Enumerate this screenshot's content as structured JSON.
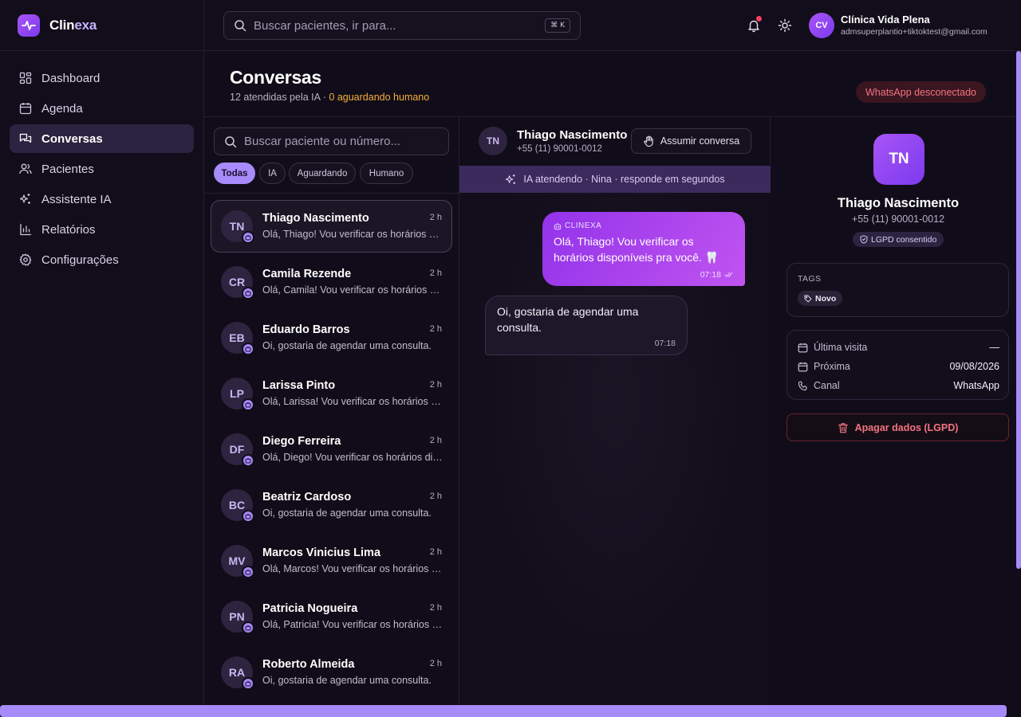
{
  "brand": {
    "name_prefix": "Clin",
    "name_suffix": "exa"
  },
  "sidebar": {
    "items": [
      {
        "label": "Dashboard",
        "icon": "grid-icon"
      },
      {
        "label": "Agenda",
        "icon": "calendar-icon"
      },
      {
        "label": "Conversas",
        "icon": "chat-icon",
        "active": true
      },
      {
        "label": "Pacientes",
        "icon": "users-icon"
      },
      {
        "label": "Assistente IA",
        "icon": "sparkles-icon"
      },
      {
        "label": "Relatórios",
        "icon": "bar-chart-icon"
      },
      {
        "label": "Configurações",
        "icon": "gear-icon"
      }
    ]
  },
  "topbar": {
    "search_placeholder": "Buscar pacientes, ir para...",
    "shortcut": "⌘ K",
    "user": {
      "initials": "CV",
      "name": "Clínica Vida Plena",
      "email": "admsuperplantio+tiktoktest@gmail.com"
    }
  },
  "header": {
    "title": "Conversas",
    "subtitle_prefix": "12 atendidas pela IA · ",
    "subtitle_warn": "0 aguardando humano",
    "whatsapp_status": "WhatsApp desconectado"
  },
  "conversations": {
    "search_placeholder": "Buscar paciente ou número...",
    "filters": [
      "Todas",
      "IA",
      "Aguardando",
      "Humano"
    ],
    "items": [
      {
        "initials": "TN",
        "name": "Thiago Nascimento",
        "time": "2 h",
        "preview": "Olá, Thiago! Vou verificar os horários disponíveis pra você."
      },
      {
        "initials": "CR",
        "name": "Camila Rezende",
        "time": "2 h",
        "preview": "Olá, Camila! Vou verificar os horários disponíveis pra você."
      },
      {
        "initials": "EB",
        "name": "Eduardo Barros",
        "time": "2 h",
        "preview": "Oi, gostaria de agendar uma consulta."
      },
      {
        "initials": "LP",
        "name": "Larissa Pinto",
        "time": "2 h",
        "preview": "Olá, Larissa! Vou verificar os horários disponíveis pra você."
      },
      {
        "initials": "DF",
        "name": "Diego Ferreira",
        "time": "2 h",
        "preview": "Olá, Diego! Vou verificar os horários disponíveis pra você."
      },
      {
        "initials": "BC",
        "name": "Beatriz Cardoso",
        "time": "2 h",
        "preview": "Oi, gostaria de agendar uma consulta."
      },
      {
        "initials": "MV",
        "name": "Marcos Vinicius Lima",
        "time": "2 h",
        "preview": "Olá, Marcos! Vou verificar os horários disponíveis pra você."
      },
      {
        "initials": "PN",
        "name": "Patricia Nogueira",
        "time": "2 h",
        "preview": "Olá, Patricia! Vou verificar os horários disponíveis pra você."
      },
      {
        "initials": "RA",
        "name": "Roberto Almeida",
        "time": "2 h",
        "preview": "Oi, gostaria de agendar uma consulta."
      }
    ]
  },
  "chat": {
    "initials": "TN",
    "name": "Thiago Nascimento",
    "phone": "+55 (11) 90001-0012",
    "take_over_label": "Assumir conversa",
    "ia_banner": "IA atendendo · Nina · responde em segundos",
    "outgoing": {
      "tag": "CLINEXA",
      "text": "Olá, Thiago! Vou verificar os horários disponíveis pra você. 🦷",
      "time": "07:18"
    },
    "incoming": {
      "text": "Oi, gostaria de agendar uma consulta.",
      "time": "07:18"
    }
  },
  "patient": {
    "initials": "TN",
    "name": "Thiago Nascimento",
    "phone": "+55 (11) 90001-0012",
    "consent_badge": "LGPD consentido",
    "tags_label": "TAGS",
    "tags": [
      "Novo"
    ],
    "details": [
      {
        "icon": "calendar-icon",
        "label": "Última visita",
        "value": "—"
      },
      {
        "icon": "calendar-icon",
        "label": "Próxima",
        "value": "09/08/2026"
      },
      {
        "icon": "phone-icon",
        "label": "Canal",
        "value": "WhatsApp"
      }
    ],
    "erase_label": "Apagar dados (LGPD)"
  },
  "colors": {
    "accent": "#a78bfa",
    "brand_gradient_start": "#a855f7",
    "brand_gradient_end": "#7c3aed",
    "danger": "#f27480",
    "warning": "#f5b03a"
  }
}
